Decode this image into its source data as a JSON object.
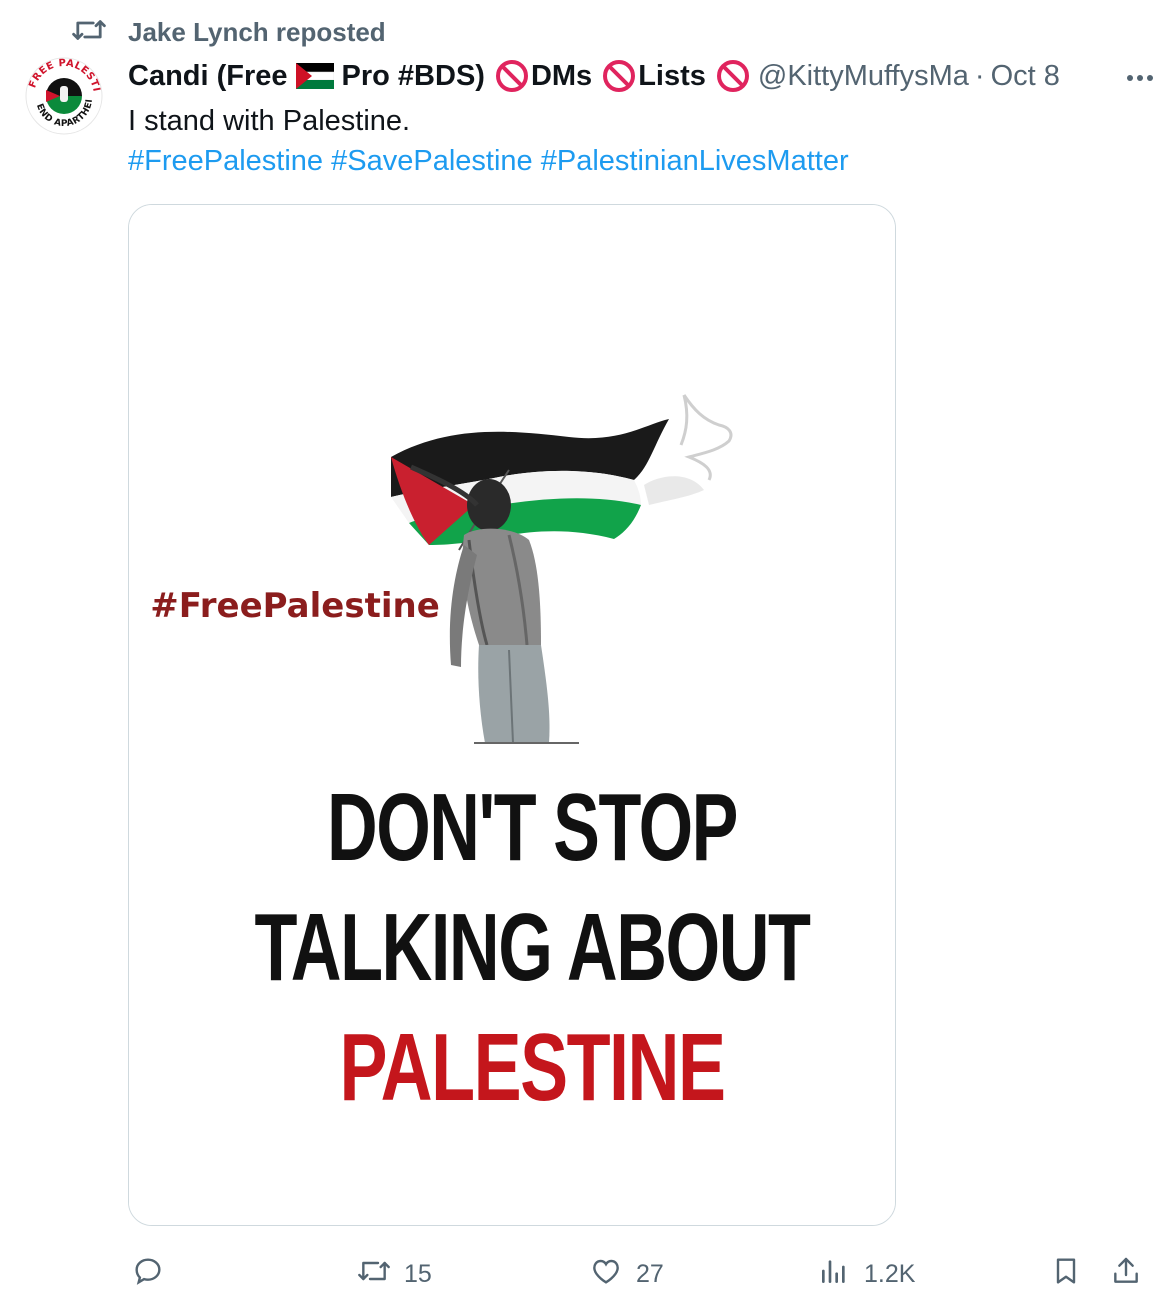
{
  "repost": {
    "label": "Jake Lynch reposted",
    "icon": "repost-icon"
  },
  "author": {
    "name_part1": "Candi (Free",
    "name_part2": "Pro #BDS)",
    "dms_label": "DMs",
    "lists_label": "Lists",
    "handle": "@KittyMuffysMa",
    "separator": "·",
    "date": "Oct 8",
    "avatar_text_top": "FREE PALESTINE",
    "avatar_text_bottom": "END APARTHEID"
  },
  "tweet": {
    "text": "I stand with Palestine.",
    "hashtags": [
      "#FreePalestine",
      "#SavePalestine",
      "#PalestinianLivesMatter"
    ]
  },
  "media": {
    "hashtag": "#FreePalestine",
    "line1": "DON'T STOP",
    "line2": "TALKING ABOUT",
    "line3": "PALESTINE"
  },
  "actions": {
    "reply_count": "",
    "retweet_count": "15",
    "like_count": "27",
    "views_count": "1.2K"
  },
  "colors": {
    "link": "#1d9bf0",
    "muted": "#536471",
    "flag_red": "#ce1126",
    "flag_green": "#007a3d",
    "no_sign_red": "#e0245e",
    "poster_red": "#c4161c"
  }
}
